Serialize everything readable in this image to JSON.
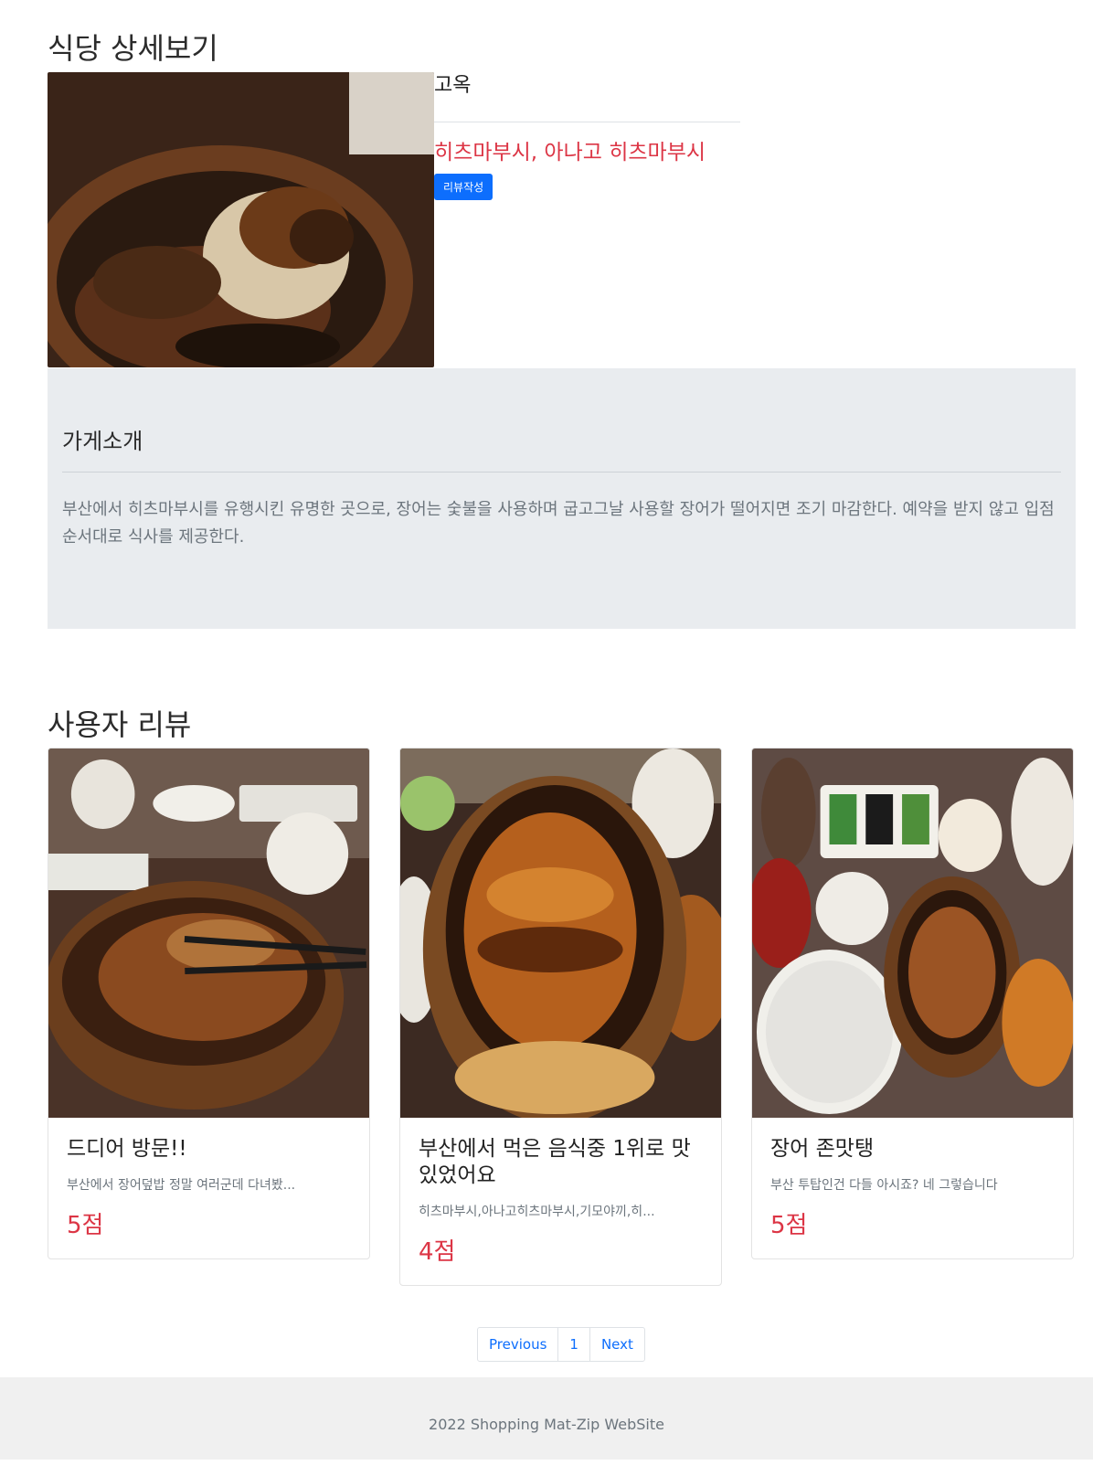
{
  "page": {
    "title": "식당 상세보기"
  },
  "restaurant": {
    "category": "고옥",
    "menu": "히츠마부시, 아나고 히츠마부시",
    "review_button": "리뷰작성",
    "intro_title": "가게소개",
    "intro_text": "부산에서 히츠마부시를 유행시킨 유명한 곳으로, 장어는 숯불을 사용하며 굽고그날 사용할 장어가 떨어지면 조기 마감한다. 예약을 받지 않고 입점순서대로 식사를 제공한다."
  },
  "reviews": {
    "title": "사용자 리뷰",
    "items": [
      {
        "title": "드디어 방문!!",
        "text": "부산에서 장어덮밥 정말 여러군데 다녀봤...",
        "score": "5점"
      },
      {
        "title": "부산에서 먹은 음식중 1위로 맛있었어요",
        "text": "히츠마부시,아나고히츠마부시,기모야끼,히...",
        "score": "4점"
      },
      {
        "title": "장어 존맛탱",
        "text": "부산 투탑인건 다들 아시죠? 네 그렇습니다",
        "score": "5점"
      }
    ]
  },
  "pagination": {
    "previous": "Previous",
    "page": "1",
    "next": "Next"
  },
  "footer": {
    "text": "2022 Shopping Mat-Zip WebSite"
  },
  "colors": {
    "accent_red": "#dc3545",
    "primary_blue": "#0d6efd",
    "intro_bg": "#e9ecef",
    "footer_bg": "#f0f0f0"
  }
}
